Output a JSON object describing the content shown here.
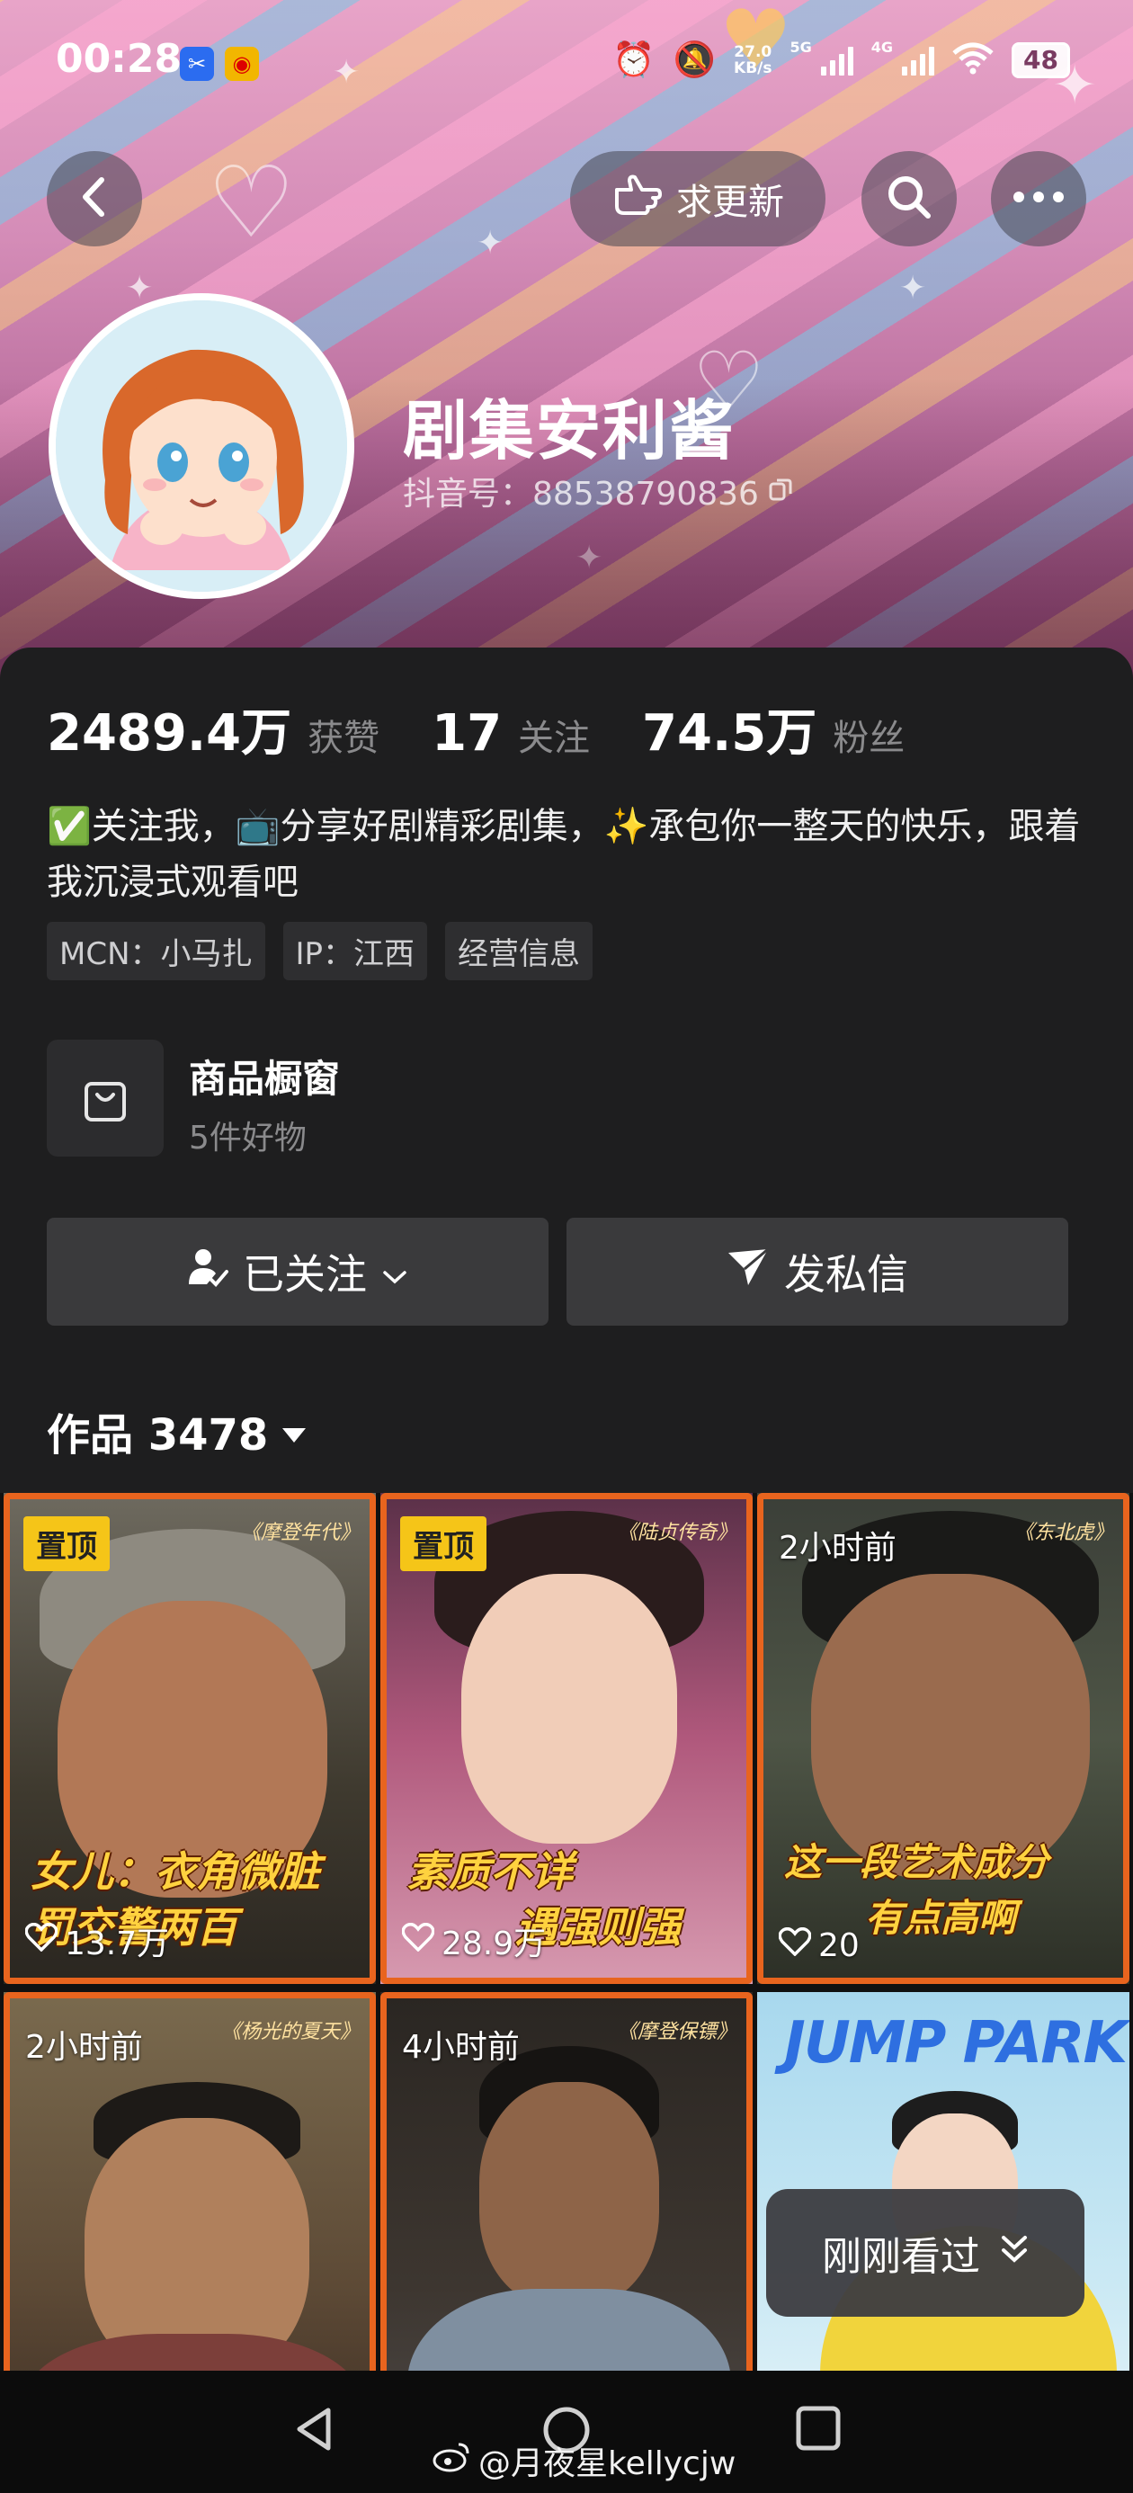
{
  "status_bar": {
    "time": "00:28",
    "net_speed": "27.0",
    "net_unit": "KB/s",
    "tech_1": "5G",
    "tech_2": "4G",
    "battery": "48"
  },
  "top_nav": {
    "back_icon": "chevron-left-icon",
    "request_update_label": "求更新",
    "search_icon": "search-icon",
    "more_icon": "more-horizontal-icon"
  },
  "profile": {
    "name": "剧集安利酱",
    "douyin_id": "抖音号：88538790836"
  },
  "stats": [
    {
      "value": "2489.4万",
      "label": "获赞"
    },
    {
      "value": "17",
      "label": "关注"
    },
    {
      "value": "74.5万",
      "label": "粉丝"
    }
  ],
  "bio": "✅关注我，📺分享好剧精彩剧集，✨承包你一整天的快乐，跟着我沉浸式观看吧",
  "tags": [
    "MCN：小马扎",
    "IP：江西",
    "经营信息"
  ],
  "shop": {
    "title": "商品橱窗",
    "subtitle": "5件好物"
  },
  "actions": {
    "follow_label": "已关注",
    "message_label": "发私信"
  },
  "works": {
    "label": "作品 3478"
  },
  "videos": [
    {
      "badge": "置顶",
      "show": "《摩登年代》",
      "caption_1": "女儿：衣角微脏",
      "caption_2": "罚交警两百",
      "likes": "13.7万"
    },
    {
      "badge": "置顶",
      "show": "《陆贞传奇》",
      "caption_1": "素质不详",
      "caption_2": "遇强则强",
      "likes": "28.9万"
    },
    {
      "time": "2小时前",
      "show": "《东北虎》",
      "caption_1": "这一段艺术成分",
      "caption_2": "有点高啊",
      "likes": "20"
    },
    {
      "time": "2小时前",
      "show": "《杨光的夏天》"
    },
    {
      "time": "4小时前",
      "show": "《摩登保镖》"
    },
    {
      "brand": "JUMP PARK"
    }
  ],
  "recent": {
    "label": "刚刚看过"
  },
  "watermark": "@月夜星kellycjw",
  "colors": {
    "accent_orange": "#e8641e",
    "pin_yellow": "#f5c518",
    "panel_bg": "#1e1e1f"
  }
}
